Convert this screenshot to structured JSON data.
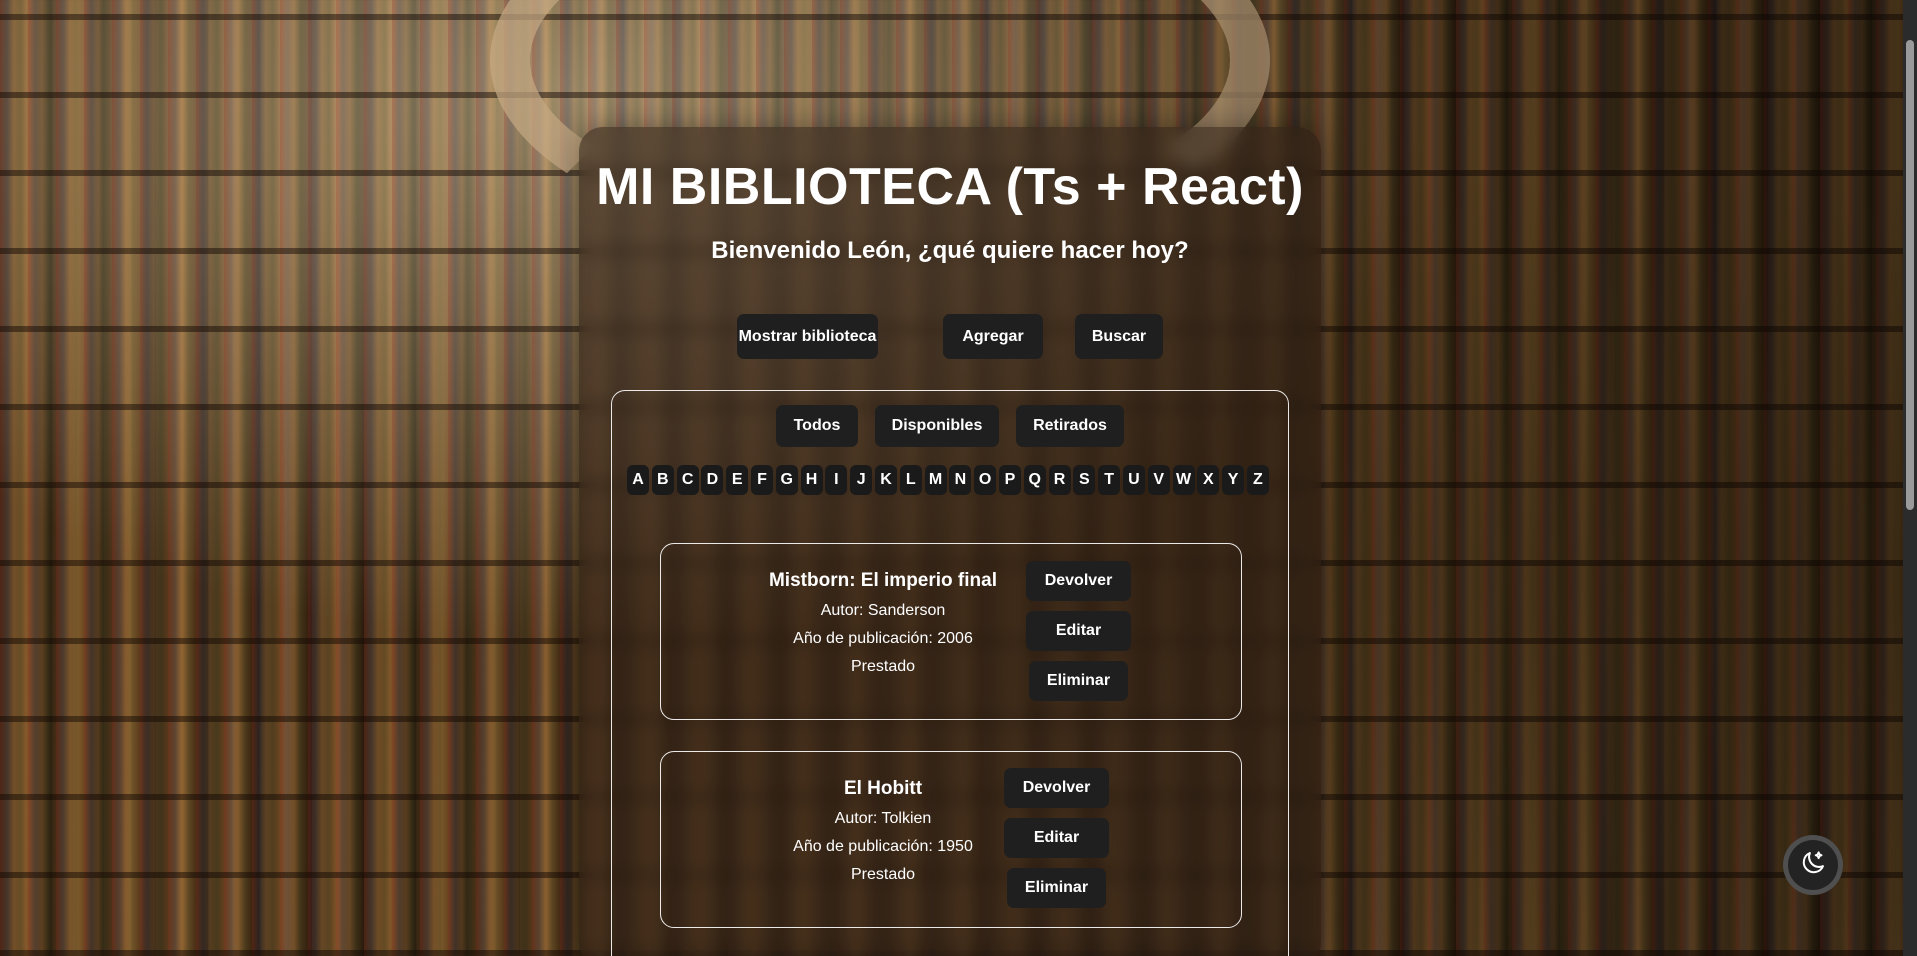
{
  "header": {
    "title": "MI BIBLIOTECA (Ts + React)",
    "subtitle": "Bienvenido León, ¿qué quiere hacer hoy?"
  },
  "nav": {
    "show_library": "Mostrar biblioteca",
    "add": "Agregar",
    "search": "Buscar"
  },
  "filters": {
    "all": "Todos",
    "available": "Disponibles",
    "withdrawn": "Retirados"
  },
  "alphabet": [
    "A",
    "B",
    "C",
    "D",
    "E",
    "F",
    "G",
    "H",
    "I",
    "J",
    "K",
    "L",
    "M",
    "N",
    "O",
    "P",
    "Q",
    "R",
    "S",
    "T",
    "U",
    "V",
    "W",
    "X",
    "Y",
    "Z"
  ],
  "books": [
    {
      "title": "Mistborn: El imperio final",
      "author": "Autor: Sanderson",
      "year": "Año de publicación: 2006",
      "status": "Prestado",
      "return_label": "Devolver",
      "edit_label": "Editar",
      "delete_label": "Eliminar"
    },
    {
      "title": "El Hobitt",
      "author": "Autor: Tolkien",
      "year": "Año de publicación: 1950",
      "status": "Prestado",
      "return_label": "Devolver",
      "edit_label": "Editar",
      "delete_label": "Eliminar"
    }
  ],
  "theme_toggle": {
    "icon": "moon-stars-icon"
  }
}
